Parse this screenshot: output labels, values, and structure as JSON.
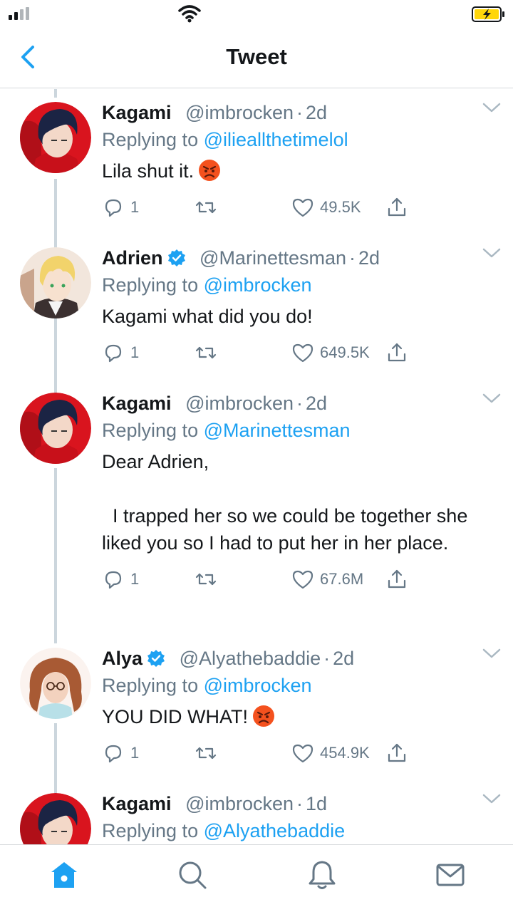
{
  "header": {
    "title": "Tweet"
  },
  "tweets": [
    {
      "name": "Kagami",
      "verified": false,
      "handle": "@imbrocken",
      "time": "2d",
      "replying_prefix": "Replying to ",
      "replying_to": "@ilieallthetimelol",
      "text": "Lila shut it.",
      "emoji": "angry-face",
      "replies": "1",
      "likes": "49.5K",
      "avatar": "kagami"
    },
    {
      "name": "Adrien",
      "verified": true,
      "handle": "@Marinettesman",
      "time": "2d",
      "replying_prefix": "Replying to ",
      "replying_to": "@imbrocken",
      "text": "Kagami what did you do!",
      "emoji": null,
      "replies": "1",
      "likes": "649.5K",
      "avatar": "adrien"
    },
    {
      "name": "Kagami",
      "verified": false,
      "handle": "@imbrocken",
      "time": "2d",
      "replying_prefix": "Replying to ",
      "replying_to": "@Marinettesman",
      "text": "Dear Adrien,\n\n  I trapped her so we could be together she liked you so I had to put her in her place.",
      "emoji": null,
      "replies": "1",
      "likes": "67.6M",
      "avatar": "kagami"
    },
    {
      "name": "Alya",
      "verified": true,
      "handle": "@Alyathebaddie",
      "time": "2d",
      "replying_prefix": "Replying to ",
      "replying_to": "@imbrocken",
      "text": "YOU DID WHAT!",
      "emoji": "angry-face",
      "replies": "1",
      "likes": "454.9K",
      "avatar": "alya"
    },
    {
      "name": "Kagami",
      "verified": false,
      "handle": "@imbrocken",
      "time": "1d",
      "replying_prefix": "Replying to ",
      "replying_to": "@Alyathebaddie",
      "text": "",
      "emoji": null,
      "replies": "",
      "likes": "",
      "avatar": "kagami"
    }
  ],
  "tab_bar": {
    "items": [
      "home-icon",
      "search-icon",
      "notifications-icon",
      "messages-icon"
    ],
    "active": "home-icon"
  },
  "colors": {
    "accent": "#1da1f2",
    "muted": "#657786",
    "text": "#14171a",
    "divider": "#d6d9db"
  }
}
